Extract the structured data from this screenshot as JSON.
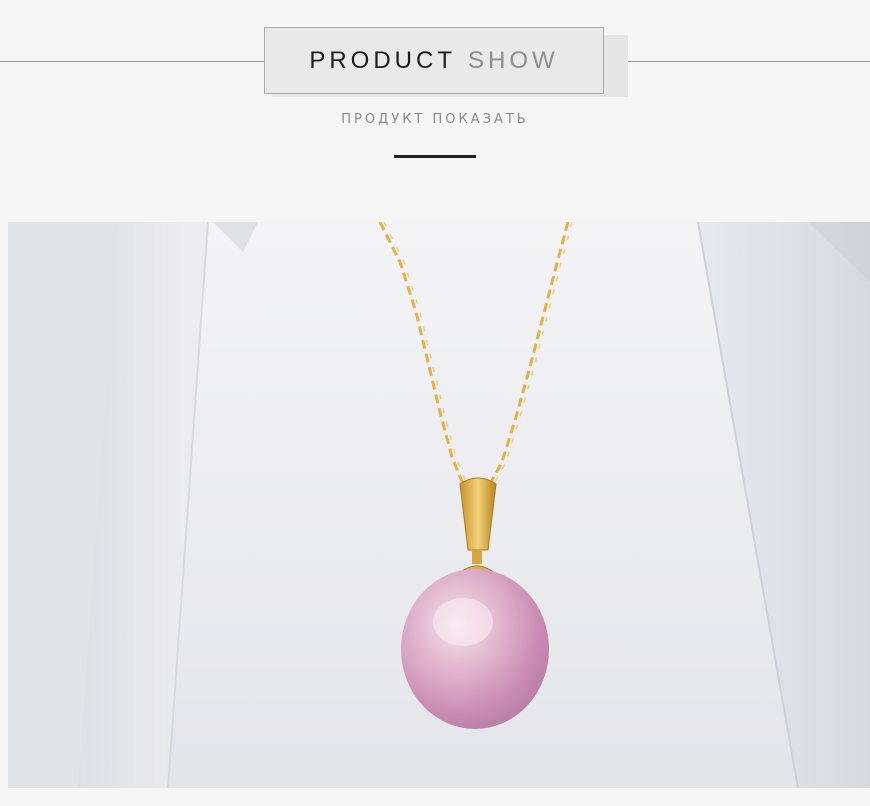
{
  "header": {
    "title_primary": "PRODUCT",
    "title_secondary": "SHOW",
    "subtitle": "ПРОДУКТ ПОКАЗАТЬ"
  },
  "photo": {
    "subject": "pearl-pendant-necklace",
    "colors": {
      "background": "#dcdde2",
      "chain": "#e2b24a",
      "pearl": "#d9a9c4"
    }
  }
}
